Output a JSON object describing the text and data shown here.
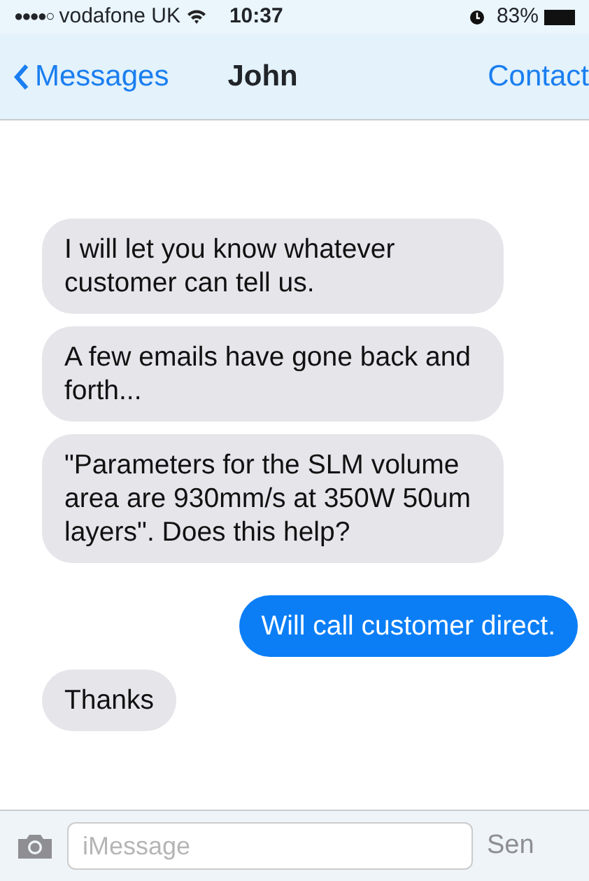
{
  "status_bar": {
    "signal": "●●●●○",
    "carrier": "vodafone UK",
    "time": "10:37",
    "battery": "83%"
  },
  "nav": {
    "back": "Messages",
    "title": "John",
    "action": "Contact"
  },
  "messages": [
    {
      "kind": "incoming",
      "text": "I will let you know whatever customer can tell us."
    },
    {
      "kind": "incoming",
      "text": "A few emails have gone back and forth..."
    },
    {
      "kind": "incoming",
      "text": "\"Parameters for the SLM volume area are 930mm/s at 350W 50um layers\". Does this help?"
    },
    {
      "kind": "outgoing",
      "text": "Will call customer direct."
    },
    {
      "kind": "incoming",
      "text": "Thanks"
    }
  ],
  "composer": {
    "placeholder": "iMessage",
    "send": "Sen"
  }
}
